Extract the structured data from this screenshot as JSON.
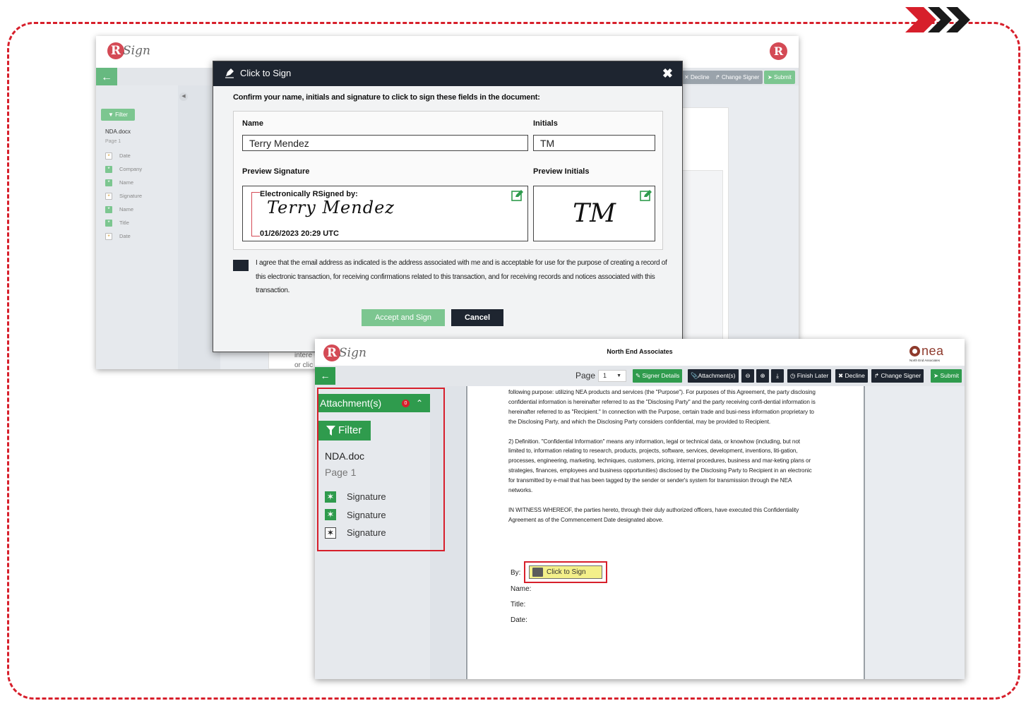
{
  "colors": {
    "accent_green": "#2f9b4d",
    "dark": "#1e2530",
    "highlight_red": "#d71f2b",
    "sign_yellow": "#f3f08a"
  },
  "back_window": {
    "logo_letter": "R",
    "logo_word": "Sign",
    "logo_right_letter": "R",
    "toolbar": {
      "decline": "Decline",
      "change_signer": "Change Signer",
      "submit": "Submit"
    },
    "filter": "Filter",
    "doc_name": "NDA.docx",
    "page": "Page 1",
    "fields": [
      {
        "label": "Date",
        "icon": "star-outline-icon"
      },
      {
        "label": "Company",
        "icon": "star-filled-icon"
      },
      {
        "label": "Name",
        "icon": "star-filled-icon"
      },
      {
        "label": "Signature",
        "icon": "star-outline-icon"
      },
      {
        "label": "Name",
        "icon": "star-filled-icon"
      },
      {
        "label": "Title",
        "icon": "star-filled-icon"
      },
      {
        "label": "Date",
        "icon": "star-outline-icon"
      }
    ],
    "doc_snippet_1": "intere",
    "doc_snippet_2": "or clic"
  },
  "modal": {
    "title": "Click to Sign",
    "intro": "Confirm your name, initials and signature to click to sign these fields in the document:",
    "name_label": "Name",
    "name_value": "Terry Mendez",
    "initials_label": "Initials",
    "initials_value": "TM",
    "preview_signature_label": "Preview Signature",
    "preview_initials_label": "Preview Initials",
    "signature_header": "Electronically RSigned by:",
    "signature_script": "Terry Mendez",
    "signature_date": "01/26/2023 20:29 UTC",
    "initials_script": "TM",
    "agreement": "I agree that the email address as indicated is the address associated with me and is acceptable for use for the purpose of creating a record of this electronic transaction, for receiving confirmations related to this transaction, and for receiving records and notices associated with this transaction.",
    "accept": "Accept and Sign",
    "cancel": "Cancel"
  },
  "front_window": {
    "logo_letter": "R",
    "logo_word": "Sign",
    "title": "North End Associates",
    "nea_logo": "nea",
    "nea_sub": "North End Associates",
    "page_label": "Page",
    "page_value": "1",
    "toolbar": {
      "signer_details": "Signer Details",
      "attachments": "Attachment(s)",
      "finish_later": "Finish Later",
      "decline": "Decline",
      "change_signer": "Change Signer",
      "submit": "Submit"
    },
    "sidebar": {
      "attachments": "Attachment(s)",
      "attachment_count": "0",
      "filter": "Filter",
      "doc_name": "NDA.doc",
      "page": "Page 1",
      "fields": [
        {
          "label": "Signature",
          "icon": "star-filled-icon"
        },
        {
          "label": "Signature",
          "icon": "star-filled-icon"
        },
        {
          "label": "Signature",
          "icon": "star-outline-icon"
        }
      ]
    },
    "document": {
      "para1": "following purpose: utilizing NEA products and services (the \"Purpose\"). For purposes of this Agreement, the party disclosing confidential information is hereinafter referred to as the \"Disclosing Party\" and the party receiving confi-dential information is hereinafter referred to as \"Recipient.\" In connection with the Purpose, certain trade and busi-ness information proprietary to the Disclosing Party, and which the Disclosing Party considers confidential, may be provided to Recipient.",
      "para2": "2) Definition.  \"Confidential Information\" means any information, legal or technical data, or knowhow (including, but not limited to, information relating to research, products, projects, software, services, development, inventions, liti-gation, processes, engineering, marketing, techniques, customers, pricing, internal procedures, business and mar-keting plans or strategies, finances, employees and business opportunities) disclosed by the Disclosing Party to Recipient in an electronic for transmitted by e-mail that has been tagged by the sender or sender's system for transmission through the NEA networks.",
      "para3": "IN WITNESS WHEREOF, the parties hereto, through their duly authorized officers, have executed this Confidentiality Agreement as of the Commencement Date designated above.",
      "by": "By:",
      "name": "Name:",
      "title": "Title:",
      "date": "Date:",
      "click_to_sign": "Click to Sign"
    }
  }
}
